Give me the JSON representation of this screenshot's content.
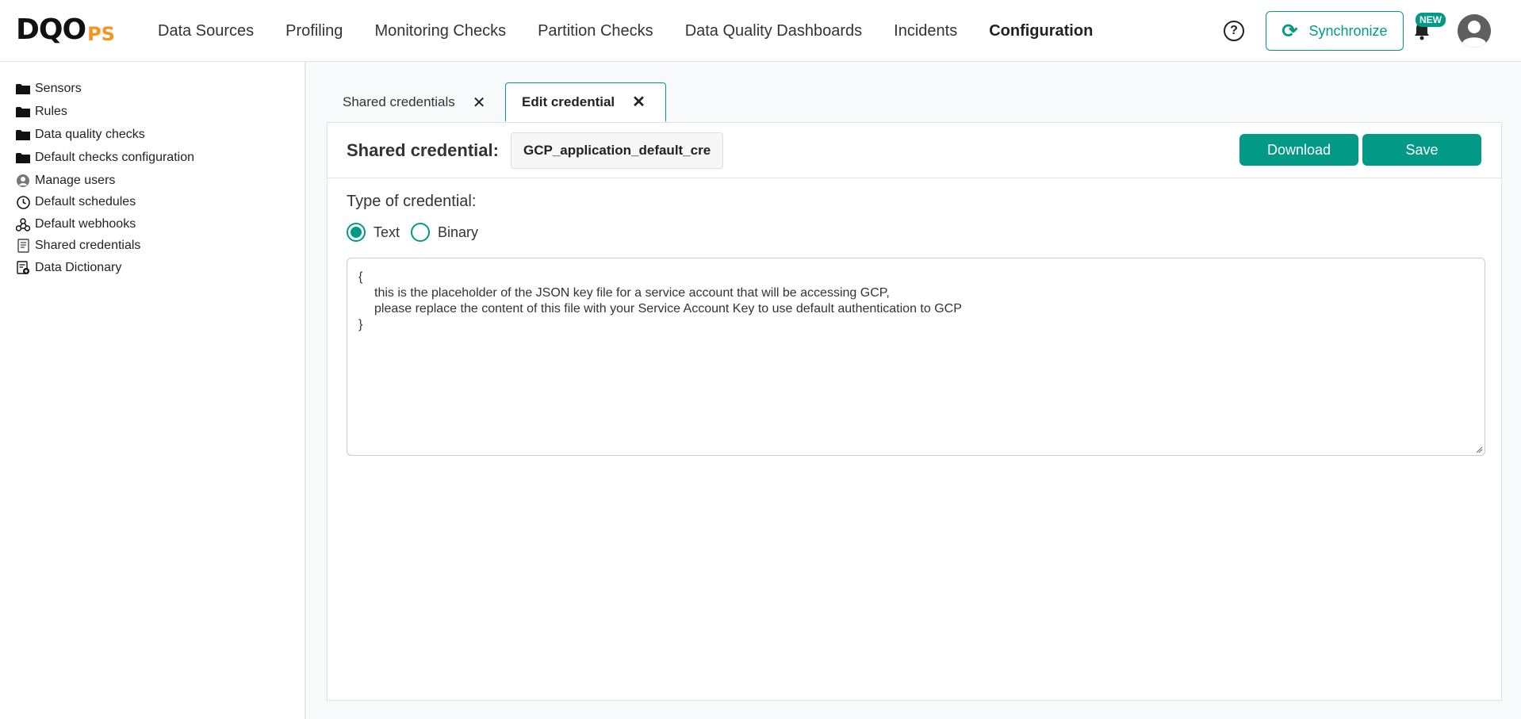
{
  "header": {
    "logo_main": "DQO",
    "logo_suffix": "PS",
    "nav": [
      "Data Sources",
      "Profiling",
      "Monitoring Checks",
      "Partition Checks",
      "Data Quality Dashboards",
      "Incidents",
      "Configuration"
    ],
    "active_nav": "Configuration",
    "help_icon": "?",
    "sync_label": "Synchronize",
    "new_badge": "NEW"
  },
  "sidebar": {
    "items": [
      {
        "label": "Sensors",
        "icon": "folder-icon"
      },
      {
        "label": "Rules",
        "icon": "folder-icon"
      },
      {
        "label": "Data quality checks",
        "icon": "folder-icon"
      },
      {
        "label": "Default checks configuration",
        "icon": "folder-icon"
      },
      {
        "label": "Manage users",
        "icon": "user-icon"
      },
      {
        "label": "Default schedules",
        "icon": "clock-icon"
      },
      {
        "label": "Default webhooks",
        "icon": "webhook-icon"
      },
      {
        "label": "Shared credentials",
        "icon": "document-icon"
      },
      {
        "label": "Data Dictionary",
        "icon": "dictionary-icon"
      }
    ]
  },
  "tabs": [
    {
      "label": "Shared credentials",
      "close": "✕"
    },
    {
      "label": "Edit credential",
      "close": "✕"
    }
  ],
  "editor": {
    "credential_label": "Shared credential:",
    "credential_name": "GCP_application_default_credentials.json",
    "download_label": "Download",
    "save_label": "Save",
    "type_label": "Type of credential:",
    "type_options": [
      "Text",
      "Binary"
    ],
    "selected_type": "Text",
    "content_lines": [
      "{",
      "this is the placeholder of the JSON key file for a service account that will be accessing GCP,",
      "please replace the content of this file with your Service Account Key to use default authentication to GCP",
      "}"
    ]
  },
  "colors": {
    "accent": "#029a86",
    "logo_orange": "#f7941d"
  }
}
